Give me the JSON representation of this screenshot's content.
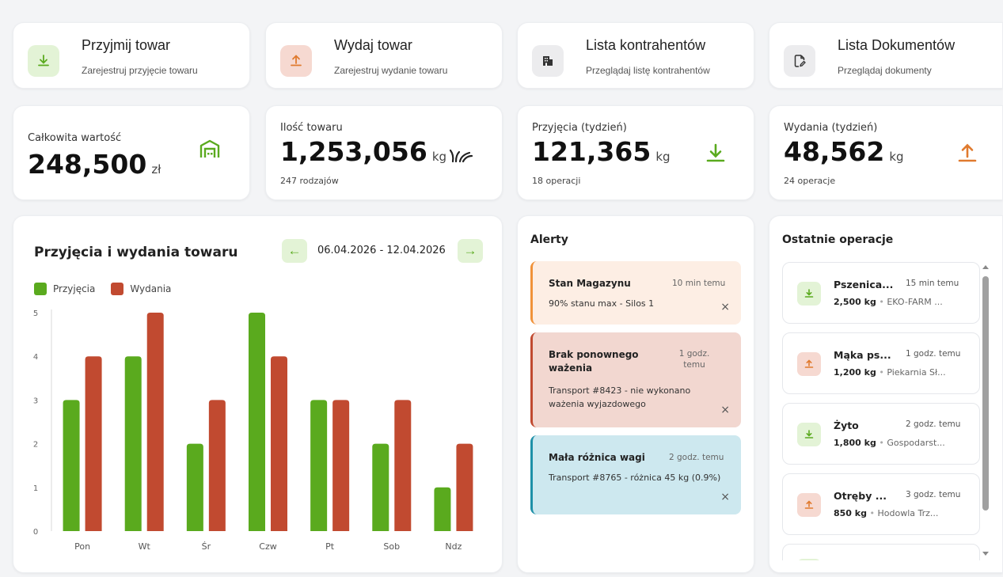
{
  "colors": {
    "green": "#5aaa1e",
    "red": "#c14a30",
    "orange": "#e07a2e",
    "teal": "#1e90a8"
  },
  "quick_actions": [
    {
      "title": "Przyjmij towar",
      "subtitle": "Zarejestruj przyjęcie towaru",
      "icon": "download-icon"
    },
    {
      "title": "Wydaj towar",
      "subtitle": "Zarejestruj wydanie towaru",
      "icon": "upload-icon"
    },
    {
      "title": "Lista kontrahentów",
      "subtitle": "Przeglądaj listę kontrahentów",
      "icon": "building-icon"
    },
    {
      "title": "Lista Dokumentów",
      "subtitle": "Przeglądaj dokumenty",
      "icon": "document-edit-icon"
    }
  ],
  "stats": [
    {
      "label": "Całkowita wartość",
      "value": "248,500",
      "unit": "zł",
      "sub": "",
      "icon": "warehouse-icon"
    },
    {
      "label": "Ilość towaru",
      "value": "1,253,056",
      "unit": "kg",
      "sub": "247 rodzajów",
      "icon": "grain-icon"
    },
    {
      "label": "Przyjęcia (tydzień)",
      "value": "121,365",
      "unit": "kg",
      "sub": "18 operacji",
      "icon": "download-icon"
    },
    {
      "label": "Wydania (tydzień)",
      "value": "48,562",
      "unit": "kg",
      "sub": "24 operacje",
      "icon": "upload-icon"
    }
  ],
  "chart_panel": {
    "title": "Przyjęcia i wydania towaru",
    "date_range": "06.04.2026 - 12.04.2026",
    "prev": "←",
    "next": "→"
  },
  "chart_data": {
    "type": "bar",
    "categories": [
      "Pon",
      "Wt",
      "Śr",
      "Czw",
      "Pt",
      "Sob",
      "Ndz"
    ],
    "series": [
      {
        "name": "Przyjęcia",
        "color": "#5aaa1e",
        "values": [
          3,
          4,
          2,
          5,
          3,
          2,
          1
        ]
      },
      {
        "name": "Wydania",
        "color": "#c14a30",
        "values": [
          4,
          5,
          3,
          4,
          3,
          3,
          2
        ]
      }
    ],
    "yticks": [
      "0",
      "1",
      "2",
      "3",
      "4",
      "5"
    ],
    "ylim": [
      0,
      5
    ],
    "legend": "top-left",
    "grid": false
  },
  "alerts_panel": {
    "title": "Alerty",
    "close": "×",
    "items": [
      {
        "title": "Stan Magazynu",
        "time": "10 min temu",
        "message": "90% stanu max - Silos 1"
      },
      {
        "title": "Brak ponownego ważenia",
        "time": "1 godz. temu",
        "message": "Transport #8423 - nie wykonano ważenia wyjazdowego"
      },
      {
        "title": "Mała różnica wagi",
        "time": "2 godz. temu",
        "message": "Transport #8765 - różnica 45 kg (0.9%)"
      }
    ]
  },
  "operations_panel": {
    "title": "Ostatnie operacje",
    "items": [
      {
        "type": "in",
        "name": "Pszenica...",
        "time": "15 min temu",
        "qty": "2,500 kg",
        "party": "EKO-FARM ..."
      },
      {
        "type": "out",
        "name": "Mąka ps...",
        "time": "1 godz. temu",
        "qty": "1,200 kg",
        "party": "Piekarnia Sł..."
      },
      {
        "type": "in",
        "name": "Żyto",
        "time": "2 godz. temu",
        "qty": "1,800 kg",
        "party": "Gospodarst..."
      },
      {
        "type": "out",
        "name": "Otręby ...",
        "time": "3 godz. temu",
        "qty": "850 kg",
        "party": "Hodowla Trz..."
      }
    ]
  }
}
